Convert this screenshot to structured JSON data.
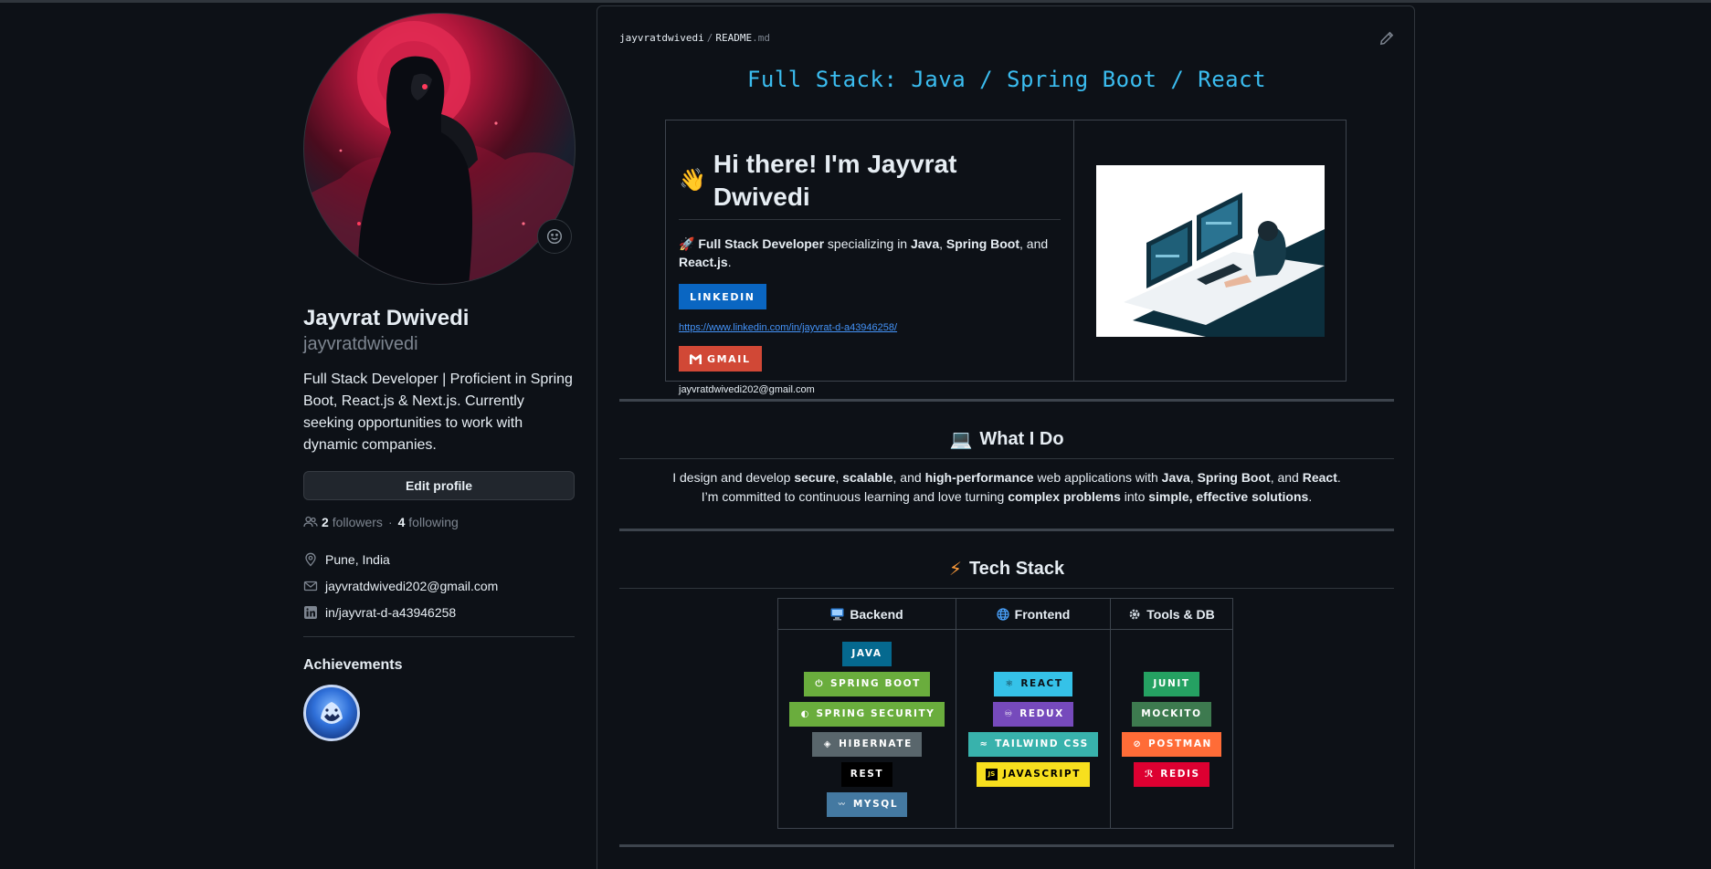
{
  "profile": {
    "full_name": "Jayvrat Dwivedi",
    "login": "jayvratdwivedi",
    "bio": "Full Stack Developer | Proficient in Spring Boot, React.js & Next.js. Currently seeking opportunities to work with dynamic companies.",
    "edit_label": "Edit profile",
    "followers_count": "2",
    "followers_label": "followers",
    "following_count": "4",
    "following_label": "following",
    "location": "Pune, India",
    "email": "jayvratdwivedi202@gmail.com",
    "linkedin": "in/jayvrat-d-a43946258",
    "achievements_title": "Achievements"
  },
  "readme": {
    "owner": "jayvratdwivedi",
    "separator": "/",
    "file_base": "README",
    "file_ext": ".md",
    "headline": "Full Stack: Java / Spring Boot / React",
    "hi_wave": "👋",
    "hi_text": "Hi there! I'm Jayvrat Dwivedi",
    "intro": {
      "emoji": "🚀",
      "role": "Full Stack Developer",
      "t1": " specializing in ",
      "java": "Java",
      "comma": ", ",
      "spring": "Spring Boot",
      "and": ", and ",
      "react": "React.js",
      "period": "."
    },
    "linkedin_badge": "LINKEDIN",
    "linkedin_url": "https://www.linkedin.com/in/jayvrat-d-a43946258/",
    "gmail_badge": "GMAIL",
    "gmail_text": "jayvratdwivedi202@gmail.com",
    "what_title": "What I Do",
    "what_emoji": "💻",
    "what": {
      "l1a": "I design and develop ",
      "secure": "secure",
      "c1": ", ",
      "scalable": "scalable",
      "c2": ", and ",
      "highperf": "high-performance",
      "l1b": " web applications with ",
      "java": "Java",
      "c3": ", ",
      "spring": "Spring Boot",
      "c4": ", and ",
      "react": "React",
      "p1": ".",
      "l2a": "I’m committed to continuous learning and love turning ",
      "complex": "complex problems",
      "l2b": " into ",
      "simple": "simple, effective solutions",
      "p2": "."
    },
    "tech_title": "Tech Stack",
    "tech_emoji": "⚡",
    "columns": {
      "backend": "Backend",
      "frontend": "Frontend",
      "tools": "Tools & DB"
    },
    "badges": {
      "java": "JAVA",
      "springboot": "SPRING BOOT",
      "springsecurity": "SPRING SECURITY",
      "hibernate": "HIBERNATE",
      "rest": "REST",
      "mysql": "MYSQL",
      "react": "REACT",
      "redux": "REDUX",
      "tailwind": "TAILWIND CSS",
      "javascript": "JAVASCRIPT",
      "junit": "JUNIT",
      "mockito": "MOCKITO",
      "postman": "POSTMAN",
      "redis": "REDIS"
    }
  },
  "colors": {
    "background": "#0d1117",
    "border": "#30363d",
    "headline": "#3bbdf0",
    "link": "#4493f8",
    "linkedin": "#0a66c2",
    "gmail": "#d14836"
  },
  "icons": [
    "smiley-icon",
    "people-icon",
    "location-icon",
    "mail-icon",
    "linkedin-icon",
    "pencil-icon",
    "computer-icon",
    "globe-icon",
    "gear-icon"
  ]
}
